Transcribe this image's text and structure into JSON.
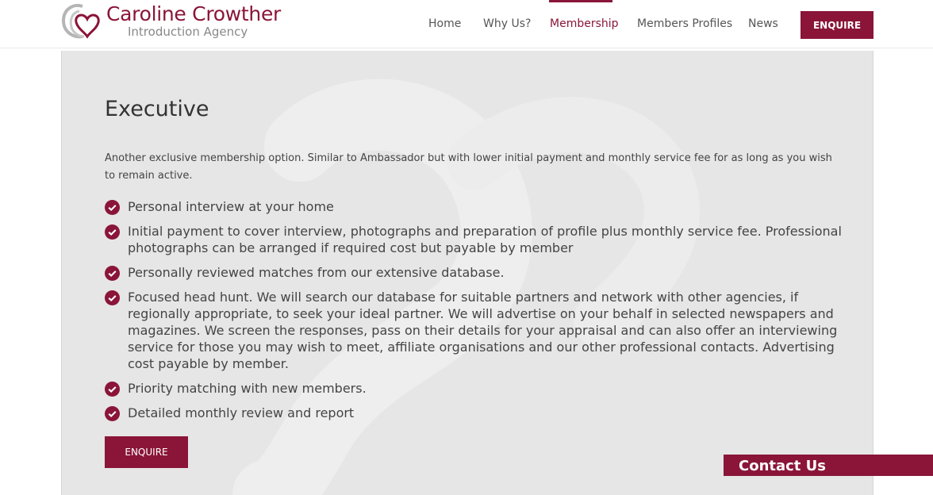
{
  "brand": {
    "name": "Caroline Crowther",
    "tagline": "Introduction Agency"
  },
  "nav": {
    "items": [
      {
        "label": "Home"
      },
      {
        "label": "Why Us?"
      },
      {
        "label": "Membership",
        "active": true
      },
      {
        "label": "Members Profiles"
      },
      {
        "label": "News"
      }
    ],
    "enquire_label": "ENQUIRE"
  },
  "main": {
    "title": "Executive",
    "intro": "Another exclusive membership option.  Similar to Ambassador but with lower initial payment and monthly service fee for as long as you wish to remain active.",
    "features": [
      "Personal interview at your home",
      "Initial payment to cover interview, photographs and preparation of profile plus monthly service fee. Professional photographs can be arranged if required cost but payable by member",
      "Personally reviewed matches from our extensive database.",
      "Focused head hunt. We will search our database for suitable partners and network with other agencies, if regionally appropriate, to seek your ideal partner. We will advertise on your behalf in selected newspapers and magazines. We screen the responses, pass on their details for your appraisal and can also offer an interviewing service for those you may wish to meet, affiliate organisations and our other professional contacts. Advertising cost payable by member.",
      "Priority matching with new members.",
      "Detailed monthly review and report"
    ],
    "enquire_label": "ENQUIRE"
  },
  "contact_tab": {
    "label": "Contact Us"
  },
  "colors": {
    "brand": "#8a1538",
    "panel_bg": "#e6e6e6"
  },
  "icons": {
    "feature_bullet": "check-circle-icon"
  }
}
